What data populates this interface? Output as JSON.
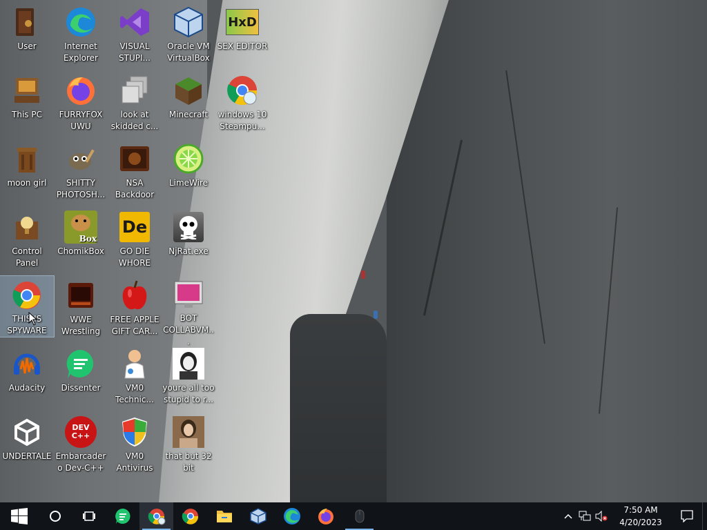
{
  "desktop": {
    "icons": [
      {
        "id": "user",
        "label": "User"
      },
      {
        "id": "ie",
        "label": "Internet Explorer"
      },
      {
        "id": "vs",
        "label": "VISUAL STUPI..."
      },
      {
        "id": "vbox",
        "label": "Oracle VM VirtualBox"
      },
      {
        "id": "sex",
        "label": "SEX EDITOR"
      },
      {
        "id": "pc",
        "label": "This PC"
      },
      {
        "id": "furry",
        "label": "FURRYFOX UWU"
      },
      {
        "id": "look",
        "label": "look at skidded c..."
      },
      {
        "id": "mc",
        "label": "Minecraft"
      },
      {
        "id": "w10",
        "label": "windows 10 Steampu..."
      },
      {
        "id": "moon",
        "label": "moon girl"
      },
      {
        "id": "shitty",
        "label": "SHITTY PHOTOSH..."
      },
      {
        "id": "nsa",
        "label": "NSA Backdoor"
      },
      {
        "id": "lime",
        "label": "LimeWire"
      },
      {
        "id": "cp",
        "label": "Control Panel"
      },
      {
        "id": "chomik",
        "label": "ChomikBox"
      },
      {
        "id": "godie",
        "label": "GO DIE WHORE"
      },
      {
        "id": "njrat",
        "label": "NjRat.exe"
      },
      {
        "id": "spy",
        "label": "THIS IS SPYWARE"
      },
      {
        "id": "wwe",
        "label": "WWE Wrestling"
      },
      {
        "id": "apple",
        "label": "FREE APPLE GIFT CAR..."
      },
      {
        "id": "bot",
        "label": "BOT COLLABVM..."
      },
      {
        "id": "aud",
        "label": "Audacity"
      },
      {
        "id": "diss",
        "label": "Dissenter"
      },
      {
        "id": "vmotech",
        "label": "VM0 Technic..."
      },
      {
        "id": "stupid",
        "label": "youre all too stupid to r..."
      },
      {
        "id": "undertale",
        "label": "UNDERTALE"
      },
      {
        "id": "devcpp",
        "label": "Embarcadero Dev-C++"
      },
      {
        "id": "vmoav",
        "label": "VM0 Antivirus"
      },
      {
        "id": "bit32",
        "label": "that but 32 bit"
      }
    ],
    "glyphs": {
      "godie": "De",
      "devcpp": "DEV C++",
      "chomik": "Box",
      "sex": "HxD"
    }
  },
  "taskbar": {
    "apps": [
      "start",
      "search",
      "task-view",
      "dissenter",
      "chrome-canary",
      "chrome",
      "file-explorer",
      "virtualbox",
      "edge",
      "firefox",
      "mouse"
    ],
    "time": "7:50 AM",
    "date": "4/20/2023"
  },
  "colors": {
    "taskbar": "#101318",
    "accent": "#7ab4e8"
  }
}
